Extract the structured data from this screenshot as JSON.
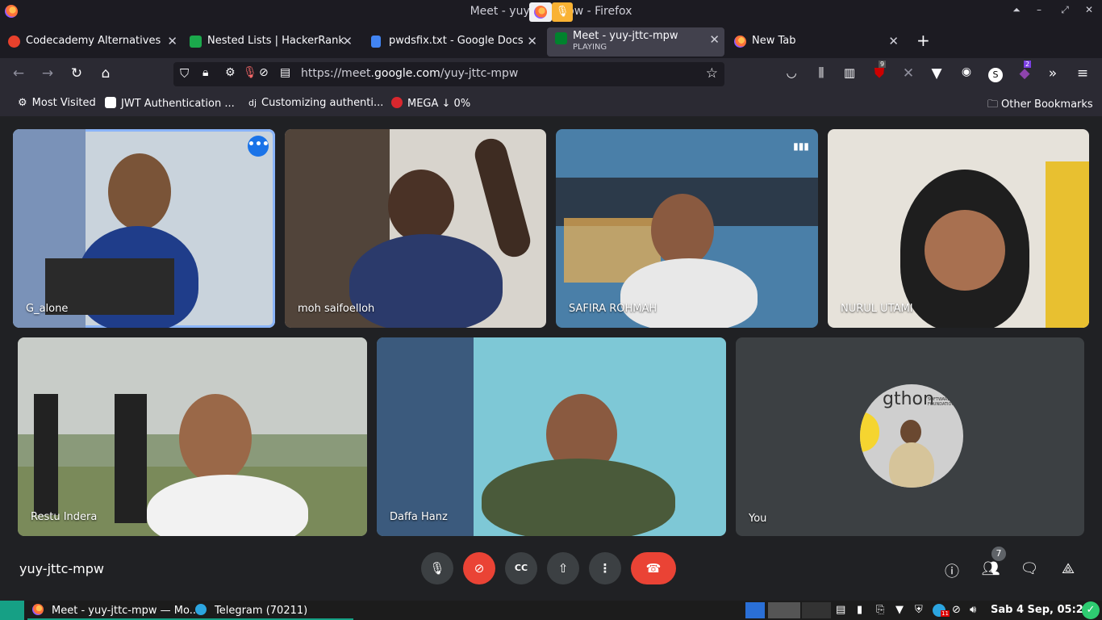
{
  "window": {
    "title": "Meet - yuy-jttc-mpw - Mozilla Firefox",
    "title_display": "Meet - yuy-jttc-mpw -            Firefox"
  },
  "tabs": [
    {
      "label": "Codecademy Alternatives",
      "icon": "codecademy-icon",
      "color": "#e8412c"
    },
    {
      "label": "Nested Lists | HackerRank",
      "icon": "hackerrank-icon",
      "color": "#1ba94c"
    },
    {
      "label": "pwdsfix.txt - Google Docs",
      "icon": "docs-icon",
      "color": "#4285f4"
    },
    {
      "label": "Meet - yuy-jttc-mpw",
      "sublabel": "PLAYING",
      "icon": "meet-icon",
      "color": "#00832d",
      "active": true
    },
    {
      "label": "New Tab",
      "icon": "firefox-icon",
      "color": "#ff7139"
    }
  ],
  "url": {
    "prefix": "https://meet.",
    "domain": "google.com",
    "path": "/yuy-jttc-mpw"
  },
  "toolbar_badges": {
    "ublock": "9",
    "ext2": "2"
  },
  "bookmarks": [
    {
      "label": "Most Visited",
      "icon": "gear-icon"
    },
    {
      "label": "JWT Authentication ...",
      "icon": "medium-icon"
    },
    {
      "label": "Customizing authenti...",
      "icon": "django-icon"
    },
    {
      "label": "MEGA ↓ 0%",
      "icon": "mega-icon"
    }
  ],
  "other_bookmarks": "Other Bookmarks",
  "participants": [
    {
      "name": "G_alone",
      "bg": "#c9d3dc",
      "shirt": "#1f3d8a",
      "speaking": true
    },
    {
      "name": "moh saifoelloh",
      "bg": "#d8d4cd",
      "shirt": "#2b3a6b"
    },
    {
      "name": "SAFIRA ROHMAH",
      "bg": "#4a7fa8",
      "shirt": "#e8e8e8"
    },
    {
      "name": "NURUL UTAMI",
      "bg": "#e6e2da",
      "shirt": "#1e1e1e"
    },
    {
      "name": "Restu Indera",
      "bg": "#8a9a7a",
      "shirt": "#f2f2f2"
    },
    {
      "name": "Daffa Hanz",
      "bg": "#7ec8d6",
      "shirt": "#4a5a3a"
    }
  ],
  "self_tile": {
    "name": "You",
    "avatar_text": "gthon",
    "avatar_subtext": "SOFTWARE FOUNDATION"
  },
  "meeting_code": "yuy-jttc-mpw",
  "participant_count": "7",
  "taskbar": {
    "window1": "Meet - yuy-jttc-mpw — Mo...",
    "window2": "Telegram (70211)",
    "clock": "Sab  4 Sep, 05:23",
    "telegram_badge": "11"
  }
}
